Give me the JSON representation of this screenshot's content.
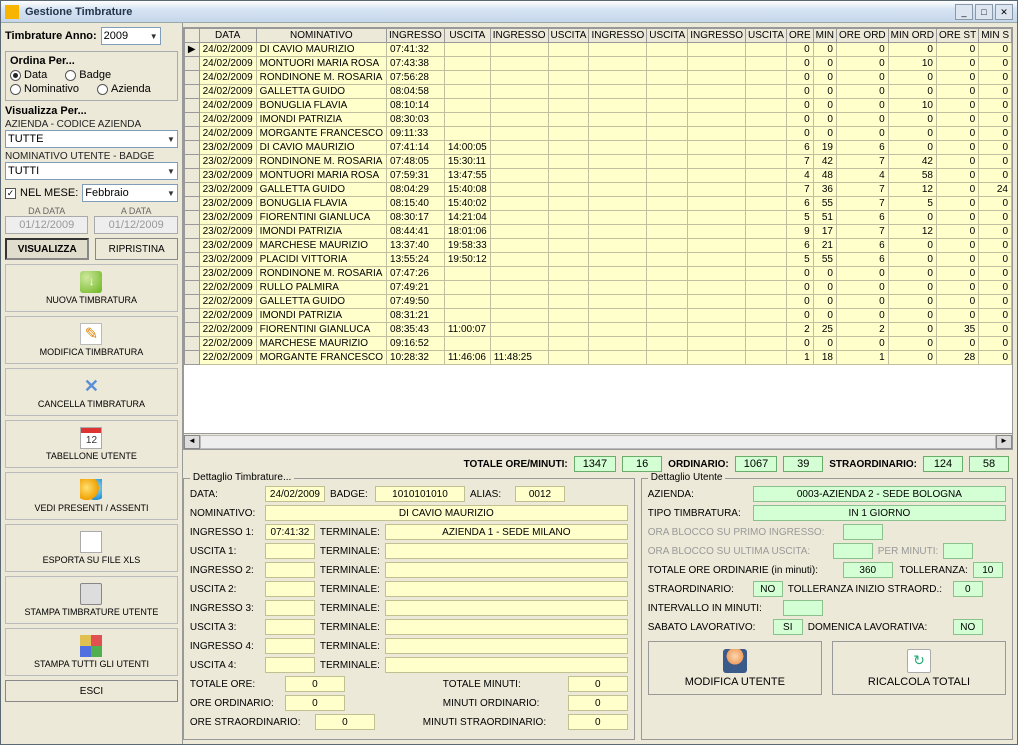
{
  "titlebar": {
    "title": "Gestione Timbrature"
  },
  "sidebar": {
    "year_label": "Timbrature Anno:",
    "year": "2009",
    "sort_title": "Ordina Per...",
    "sort_options": {
      "data": "Data",
      "badge": "Badge",
      "nominativo": "Nominativo",
      "azienda": "Azienda"
    },
    "view_title": "Visualizza Per...",
    "view_azienda_label": "AZIENDA - CODICE AZIENDA",
    "view_azienda": "TUTTE",
    "view_utente_label": "NOMINATIVO UTENTE - BADGE",
    "view_utente": "TUTTI",
    "month_check_label": "NEL MESE:",
    "month": "Febbraio",
    "da_data_label": "DA DATA",
    "a_data_label": "A DATA",
    "da_data": "01/12/2009",
    "a_data": "01/12/2009",
    "visualizza_btn": "VISUALIZZA",
    "ripristina_btn": "RIPRISTINA",
    "btn_new": "NUOVA TIMBRATURA",
    "btn_edit": "MODIFICA TIMBRATURA",
    "btn_del": "CANCELLA TIMBRATURA",
    "btn_tab": "TABELLONE UTENTE",
    "btn_pres": "VEDI PRESENTI / ASSENTI",
    "btn_xls": "ESPORTA SU FILE XLS",
    "btn_print_u": "STAMPA TIMBRATURE UTENTE",
    "btn_print_all": "STAMPA TUTTI GLI UTENTI",
    "btn_exit": "ESCI"
  },
  "grid": {
    "columns": [
      "DATA",
      "NOMINATIVO",
      "INGRESSO",
      "USCITA",
      "INGRESSO",
      "USCITA",
      "INGRESSO",
      "USCITA",
      "INGRESSO",
      "USCITA",
      "ORE",
      "MIN",
      "ORE ORD",
      "MIN ORD",
      "ORE ST",
      "MIN S"
    ],
    "rows": [
      [
        "24/02/2009",
        "DI CAVIO MAURIZIO",
        "07:41:32",
        "",
        "",
        "",
        "",
        "",
        "",
        "",
        "0",
        "0",
        "0",
        "0",
        "0",
        "0"
      ],
      [
        "24/02/2009",
        "MONTUORI MARIA ROSA",
        "07:43:38",
        "",
        "",
        "",
        "",
        "",
        "",
        "",
        "0",
        "0",
        "0",
        "10",
        "0",
        "0"
      ],
      [
        "24/02/2009",
        "RONDINONE M. ROSARIA",
        "07:56:28",
        "",
        "",
        "",
        "",
        "",
        "",
        "",
        "0",
        "0",
        "0",
        "0",
        "0",
        "0"
      ],
      [
        "24/02/2009",
        "GALLETTA GUIDO",
        "08:04:58",
        "",
        "",
        "",
        "",
        "",
        "",
        "",
        "0",
        "0",
        "0",
        "0",
        "0",
        "0"
      ],
      [
        "24/02/2009",
        "BONUGLIA FLAVIA",
        "08:10:14",
        "",
        "",
        "",
        "",
        "",
        "",
        "",
        "0",
        "0",
        "0",
        "10",
        "0",
        "0"
      ],
      [
        "24/02/2009",
        "IMONDI PATRIZIA",
        "08:30:03",
        "",
        "",
        "",
        "",
        "",
        "",
        "",
        "0",
        "0",
        "0",
        "0",
        "0",
        "0"
      ],
      [
        "24/02/2009",
        "MORGANTE FRANCESCO",
        "09:11:33",
        "",
        "",
        "",
        "",
        "",
        "",
        "",
        "0",
        "0",
        "0",
        "0",
        "0",
        "0"
      ],
      [
        "23/02/2009",
        "DI CAVIO MAURIZIO",
        "07:41:14",
        "14:00:05",
        "",
        "",
        "",
        "",
        "",
        "",
        "6",
        "19",
        "6",
        "0",
        "0",
        "0"
      ],
      [
        "23/02/2009",
        "RONDINONE M. ROSARIA",
        "07:48:05",
        "15:30:11",
        "",
        "",
        "",
        "",
        "",
        "",
        "7",
        "42",
        "7",
        "42",
        "0",
        "0"
      ],
      [
        "23/02/2009",
        "MONTUORI MARIA ROSA",
        "07:59:31",
        "13:47:55",
        "",
        "",
        "",
        "",
        "",
        "",
        "4",
        "48",
        "4",
        "58",
        "0",
        "0"
      ],
      [
        "23/02/2009",
        "GALLETTA GUIDO",
        "08:04:29",
        "15:40:08",
        "",
        "",
        "",
        "",
        "",
        "",
        "7",
        "36",
        "7",
        "12",
        "0",
        "24"
      ],
      [
        "23/02/2009",
        "BONUGLIA FLAVIA",
        "08:15:40",
        "15:40:02",
        "",
        "",
        "",
        "",
        "",
        "",
        "6",
        "55",
        "7",
        "5",
        "0",
        "0"
      ],
      [
        "23/02/2009",
        "FIORENTINI GIANLUCA",
        "08:30:17",
        "14:21:04",
        "",
        "",
        "",
        "",
        "",
        "",
        "5",
        "51",
        "6",
        "0",
        "0",
        "0"
      ],
      [
        "23/02/2009",
        "IMONDI PATRIZIA",
        "08:44:41",
        "18:01:06",
        "",
        "",
        "",
        "",
        "",
        "",
        "9",
        "17",
        "7",
        "12",
        "0",
        "0"
      ],
      [
        "23/02/2009",
        "MARCHESE MAURIZIO",
        "13:37:40",
        "19:58:33",
        "",
        "",
        "",
        "",
        "",
        "",
        "6",
        "21",
        "6",
        "0",
        "0",
        "0"
      ],
      [
        "23/02/2009",
        "PLACIDI VITTORIA",
        "13:55:24",
        "19:50:12",
        "",
        "",
        "",
        "",
        "",
        "",
        "5",
        "55",
        "6",
        "0",
        "0",
        "0"
      ],
      [
        "23/02/2009",
        "RONDINONE M. ROSARIA",
        "07:47:26",
        "",
        "",
        "",
        "",
        "",
        "",
        "",
        "0",
        "0",
        "0",
        "0",
        "0",
        "0"
      ],
      [
        "22/02/2009",
        "RULLO PALMIRA",
        "07:49:21",
        "",
        "",
        "",
        "",
        "",
        "",
        "",
        "0",
        "0",
        "0",
        "0",
        "0",
        "0"
      ],
      [
        "22/02/2009",
        "GALLETTA GUIDO",
        "07:49:50",
        "",
        "",
        "",
        "",
        "",
        "",
        "",
        "0",
        "0",
        "0",
        "0",
        "0",
        "0"
      ],
      [
        "22/02/2009",
        "IMONDI PATRIZIA",
        "08:31:21",
        "",
        "",
        "",
        "",
        "",
        "",
        "",
        "0",
        "0",
        "0",
        "0",
        "0",
        "0"
      ],
      [
        "22/02/2009",
        "FIORENTINI GIANLUCA",
        "08:35:43",
        "11:00:07",
        "",
        "",
        "",
        "",
        "",
        "",
        "2",
        "25",
        "2",
        "0",
        "35",
        "0"
      ],
      [
        "22/02/2009",
        "MARCHESE MAURIZIO",
        "09:16:52",
        "",
        "",
        "",
        "",
        "",
        "",
        "",
        "0",
        "0",
        "0",
        "0",
        "0",
        "0"
      ],
      [
        "22/02/2009",
        "MORGANTE FRANCESCO",
        "10:28:32",
        "11:46:06",
        "11:48:25",
        "",
        "",
        "",
        "",
        "",
        "1",
        "18",
        "1",
        "0",
        "28",
        "0"
      ]
    ]
  },
  "totals": {
    "label_oremin": "TOTALE ORE/MINUTI:",
    "ore": "1347",
    "min": "16",
    "label_ord": "ORDINARIO:",
    "ord_ore": "1067",
    "ord_min": "39",
    "label_str": "STRAORDINARIO:",
    "str_ore": "124",
    "str_min": "58"
  },
  "dett_t": {
    "legend": "Dettaglio Timbrature...",
    "data_lbl": "DATA:",
    "data": "24/02/2009",
    "badge_lbl": "BADGE:",
    "badge": "1010101010",
    "alias_lbl": "ALIAS:",
    "alias": "0012",
    "nom_lbl": "NOMINATIVO:",
    "nom": "DI CAVIO MAURIZIO",
    "ing1_lbl": "INGRESSO 1:",
    "ing1": "07:41:32",
    "term_lbl": "TERMINALE:",
    "term1": "AZIENDA 1 - SEDE MILANO",
    "usc1_lbl": "USCITA 1:",
    "ing2_lbl": "INGRESSO 2:",
    "usc2_lbl": "USCITA 2:",
    "ing3_lbl": "INGRESSO 3:",
    "usc3_lbl": "USCITA 3:",
    "ing4_lbl": "INGRESSO 4:",
    "usc4_lbl": "USCITA 4:",
    "tot_ore_lbl": "TOTALE ORE:",
    "tot_ore": "0",
    "tot_min_lbl": "TOTALE MINUTI:",
    "tot_min": "0",
    "ord_ore_lbl": "ORE ORDINARIO:",
    "ord_ore": "0",
    "ord_min_lbl": "MINUTI ORDINARIO:",
    "ord_min": "0",
    "str_ore_lbl": "ORE STRAORDINARIO:",
    "str_ore": "0",
    "str_min_lbl": "MINUTI STRAORDINARIO:",
    "str_min": "0"
  },
  "dett_u": {
    "legend": "Dettaglio Utente",
    "az_lbl": "AZIENDA:",
    "az": "0003-AZIENDA 2 - SEDE BOLOGNA",
    "tipo_lbl": "TIPO TIMBRATURA:",
    "tipo": "IN 1 GIORNO",
    "blocco1_lbl": "ORA BLOCCO SU PRIMO INGRESSO:",
    "blocco2_lbl": "ORA BLOCCO SU ULTIMA USCITA:",
    "permin_lbl": "PER MINUTI:",
    "totord_lbl": "TOTALE ORE ORDINARIE (in minuti):",
    "totord": "360",
    "toll_lbl": "TOLLERANZA:",
    "toll": "10",
    "straord_lbl": "STRAORDINARIO:",
    "straord": "NO",
    "toll_str_lbl": "TOLLERANZA INIZIO STRAORD.:",
    "toll_str": "0",
    "interv_lbl": "INTERVALLO IN MINUTI:",
    "sab_lbl": "SABATO LAVORATIVO:",
    "sab": "SI",
    "dom_lbl": "DOMENICA LAVORATIVA:",
    "dom": "NO",
    "btn_mod": "MODIFICA UTENTE",
    "btn_calc": "RICALCOLA TOTALI"
  }
}
